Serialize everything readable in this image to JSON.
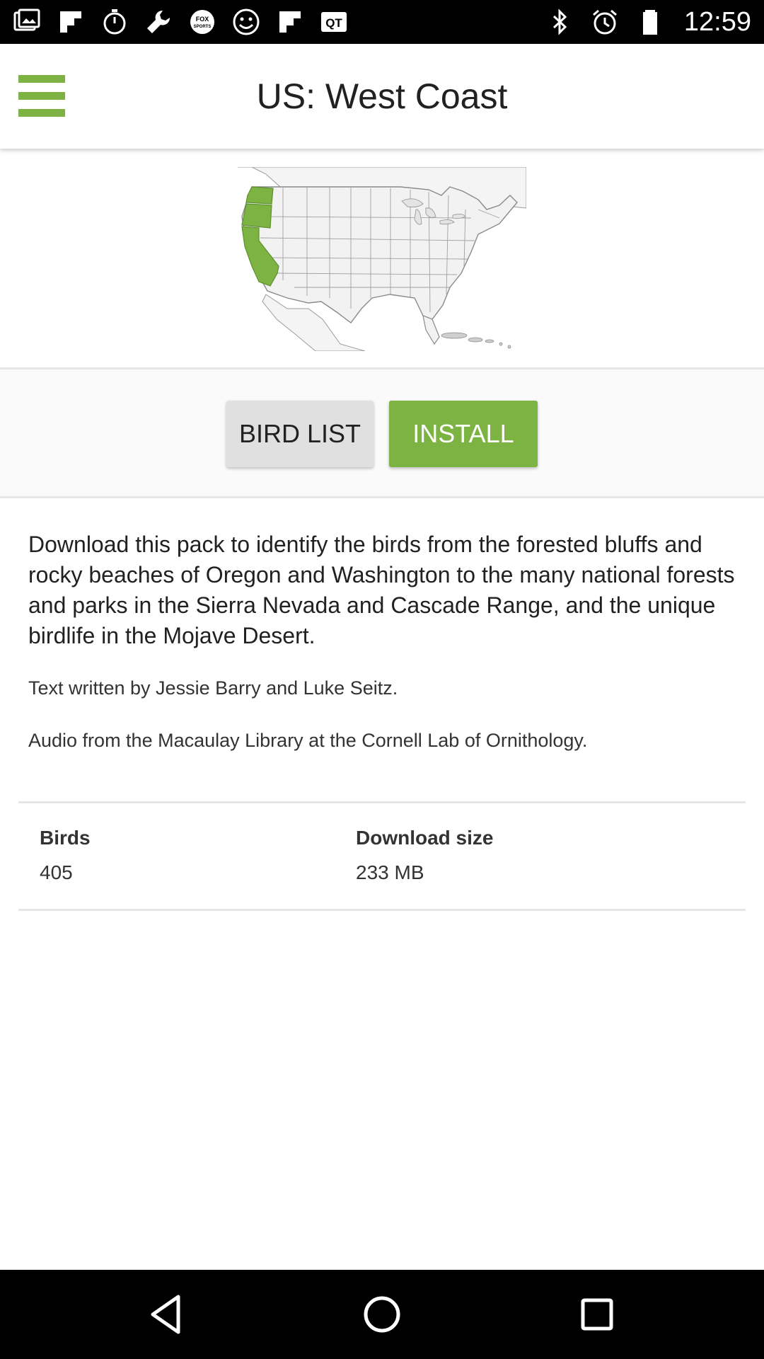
{
  "status_bar": {
    "time": "12:59",
    "left_icons": [
      "photos-icon",
      "flipboard-icon",
      "timer-icon",
      "wrench-icon",
      "fox-sports-icon",
      "smiley-icon",
      "flipboard-icon",
      "qt-icon"
    ],
    "right_icons": [
      "bluetooth-icon",
      "alarm-icon",
      "battery-icon"
    ],
    "fox_badge": "FOX\nSPORTS",
    "qt_badge": "QT"
  },
  "header": {
    "title": "US: West Coast",
    "menu_icon": "hamburger-menu-icon"
  },
  "map": {
    "highlight_color": "#7cb342",
    "highlighted_states": [
      "Washington",
      "Oregon",
      "California"
    ]
  },
  "actions": {
    "bird_list_label": "BIRD LIST",
    "install_label": "INSTALL"
  },
  "description": {
    "main": "Download this pack to identify the birds from the forested bluffs and rocky beaches of Oregon and Washington to the many national forests and parks in the Sierra Nevada and Cascade Range, and the unique birdlife in the Mojave Desert.",
    "credit": "Text written by Jessie Barry and Luke Seitz.",
    "audio": "Audio from the Macaulay Library at the Cornell Lab of Ornithology."
  },
  "stats": {
    "birds_label": "Birds",
    "birds_value": "405",
    "size_label": "Download size",
    "size_value": "233 MB"
  },
  "nav_bar": {
    "icons": [
      "back-icon",
      "home-icon",
      "recents-icon"
    ]
  },
  "colors": {
    "accent": "#7cb342",
    "button_grey": "#e0e0e0"
  }
}
